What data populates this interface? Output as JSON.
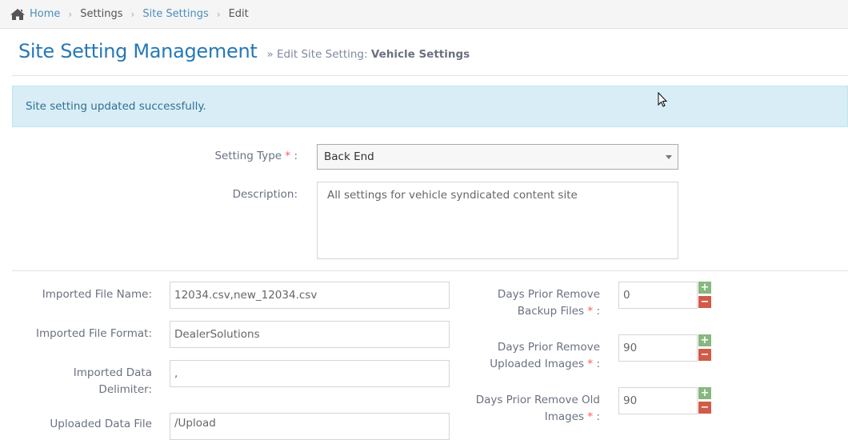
{
  "breadcrumb": {
    "items": [
      {
        "label": "Home",
        "link": true
      },
      {
        "label": "Settings",
        "link": false
      },
      {
        "label": "Site Settings",
        "link": true
      },
      {
        "label": "Edit",
        "link": false
      }
    ]
  },
  "header": {
    "title": "Site Setting Management",
    "subtitle_prefix": "» Edit Site Setting:",
    "subtitle_name": "Vehicle Settings"
  },
  "alert": {
    "message": "Site setting updated successfully.",
    "color": "#d9edf7"
  },
  "form": {
    "setting_type": {
      "label": "Setting Type",
      "required": "*",
      "colon": ":",
      "value": "Back End"
    },
    "description": {
      "label": "Description:",
      "value": "All settings for vehicle syndicated content site"
    },
    "left": [
      {
        "label": "Imported File Name:",
        "value": "12034.csv,new_12034.csv"
      },
      {
        "label": "Imported File Format:",
        "value": "DealerSolutions"
      },
      {
        "label": "Imported Data Delimiter:",
        "value": ","
      },
      {
        "label": "Uploaded Data File",
        "value": "/Upload"
      }
    ],
    "right": [
      {
        "label_a": "Days Prior Remove",
        "label_b": "Backup Files",
        "required": "*",
        "colon": ":",
        "value": "0"
      },
      {
        "label_a": "Days Prior Remove",
        "label_b": "Uploaded Images",
        "required": "*",
        "colon": ":",
        "value": "90"
      },
      {
        "label_a": "Days Prior Remove Old",
        "label_b": "Images",
        "required": "*",
        "colon": ":",
        "value": "90"
      }
    ],
    "spinner": {
      "plus": "+",
      "minus": "−",
      "plus_color": "#87b87f",
      "minus_color": "#d15b47"
    }
  }
}
